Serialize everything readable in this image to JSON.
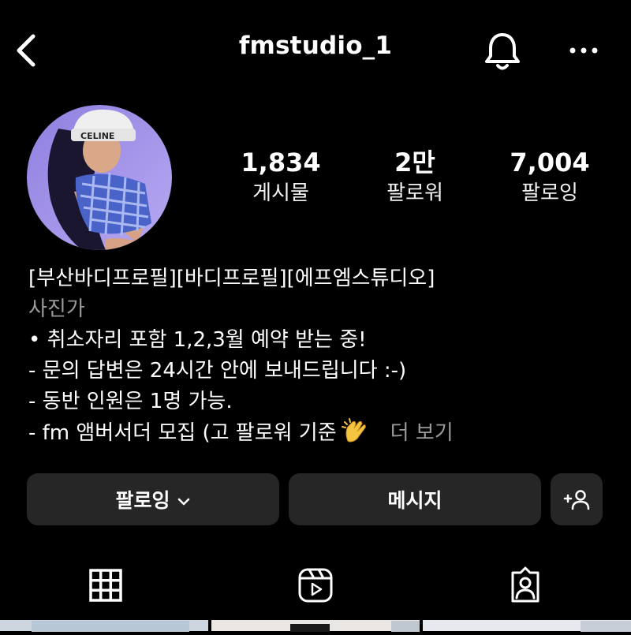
{
  "header": {
    "username": "fmstudio_1"
  },
  "profile": {
    "stats": [
      {
        "value": "1,834",
        "label": "게시물"
      },
      {
        "value": "2만",
        "label": "팔로워"
      },
      {
        "value": "7,004",
        "label": "팔로잉"
      }
    ]
  },
  "bio": {
    "name": "[부산바디프로필][바디프로필][에프엠스튜디오]",
    "category": "사진가",
    "lines": [
      "• 취소자리 포함 1,2,3월 예약 받는 중!",
      "- 문의 답변은 24시간 안에 보내드립니다 :-)",
      "- 동반 인원은 1명 가능.",
      "- fm 앰버서더 모집 (고 팔로워 기준"
    ],
    "more": "더 보기"
  },
  "actions": {
    "following": "팔로잉",
    "message": "메시지"
  },
  "tabs": [
    "grid",
    "reels",
    "tagged"
  ],
  "icons": [
    "back-icon",
    "bell-icon",
    "more-icon",
    "chevron-down-icon",
    "add-person-icon",
    "grid-icon",
    "reels-icon",
    "tagged-icon",
    "clap-emoji"
  ],
  "colors": {
    "background": "#000000",
    "button": "#262626",
    "muted_text": "#9a9a9a"
  }
}
